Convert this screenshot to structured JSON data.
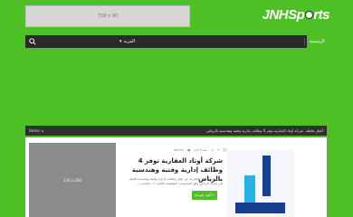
{
  "ad_top": {
    "label": "728 x 90"
  },
  "logo": {
    "text_before": "JNHSp",
    "text_after": "rts"
  },
  "nav": {
    "home_label": "الرئيسية",
    "more_label": "المزيد",
    "search_icon": "search-icon"
  },
  "ticker": {
    "label": "أخبار عاجلة",
    "text": "شركة أوتاد العقارية توفر 4 وظائف إدارية وفنية وهندسية بالرياض",
    "home_label": "Home"
  },
  "ad_side": {
    "label": "336 x 280"
  },
  "post": {
    "comments": "0",
    "date": "منذ 4 أيام",
    "author": "admin",
    "title": "شركة أوتاد العقارية توفر 4 وظائف إدارية وفنية وهندسية بالرياض",
    "excerpt": "تعلن شركة أوتاد العقارية عن توفر وظائف إدارية وفنية وهندسية للعمل في مدينة الرياض وفق المسميات الوظيفية التالية: 1- محاسب ...",
    "read_more": "أكمل القراءة »"
  },
  "colors": {
    "accent": "#4fbf26",
    "nav_bg": "#2a2a2a"
  }
}
